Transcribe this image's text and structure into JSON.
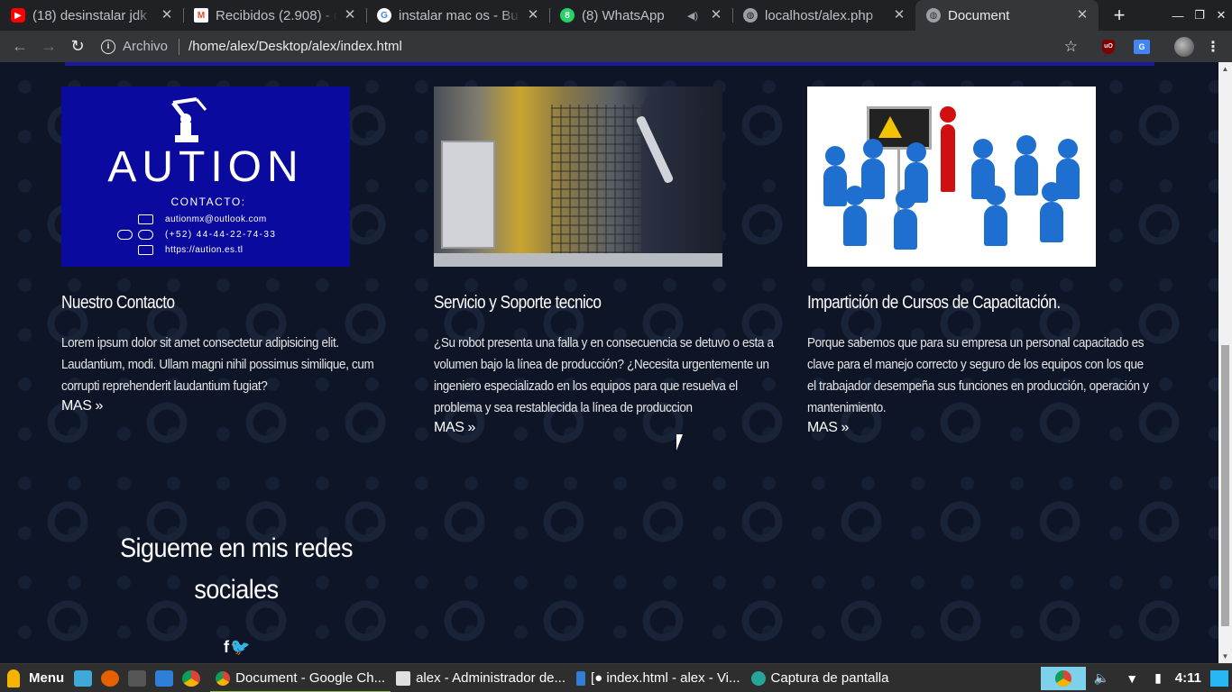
{
  "browser": {
    "tabs": [
      {
        "title": "(18) desinstalar jdk",
        "favicon": "youtube-icon",
        "color": "#ff0000",
        "active": false
      },
      {
        "title": "Recibidos (2.908) - c",
        "favicon": "gmail-icon",
        "color": "#ea4335",
        "active": false
      },
      {
        "title": "instalar mac os - Bu",
        "favicon": "google-icon",
        "color": "#4285f4",
        "active": false
      },
      {
        "title": "(8) WhatsApp",
        "favicon": "whatsapp-icon",
        "color": "#25d366",
        "active": false
      },
      {
        "title": "localhost/alex.php",
        "favicon": "globe-icon",
        "color": "#9aa0a6",
        "active": false
      },
      {
        "title": "Document",
        "favicon": "globe-icon",
        "color": "#9aa0a6",
        "active": true
      }
    ],
    "address": {
      "chip": "Archivo",
      "url": "/home/alex/Desktop/alex/index.html"
    }
  },
  "page": {
    "cards": [
      {
        "title": "Nuestro Contacto",
        "text": "Lorem ipsum dolor sit amet consectetur adipisicing elit. Laudantium, modi. Ullam magni nihil possimus similique, cum corrupti reprehenderit laudantium fugiat?",
        "more": "MAS »"
      },
      {
        "title": "Servicio y Soporte tecnico",
        "text": "¿Su robot presenta una falla y en consecuencia se detuvo o esta a volumen bajo la línea de producción? ¿Necesita urgentemente un ingeniero especializado en los equipos para que resuelva el problema y sea restablecida la línea de produccion",
        "more": "MAS »"
      },
      {
        "title": "Impartición de Cursos de Capacitación.",
        "text": "Porque sabemos que para su empresa un personal capacitado es clave para el manejo correcto y seguro de los equipos con los que el trabajador desempeña sus funciones en producción, operación y mantenimiento.",
        "more": "MAS »"
      }
    ],
    "contact_image": {
      "brand": "AUTION",
      "heading": "CONTACTO:",
      "email": "autionmx@outlook.com",
      "phone": "(+52) 44-44-22-74-33",
      "web": "https://aution.es.tl"
    },
    "social": {
      "title": "Sigueme en mis redes sociales",
      "icons": "f🐦"
    }
  },
  "taskbar": {
    "menu": "Menu",
    "windows": [
      {
        "label": "Document - Google Ch...",
        "icon": "chrome-icon",
        "color": "#4285f4",
        "active": true
      },
      {
        "label": "alex - Administrador de...",
        "icon": "folder-icon",
        "color": "#e0e0e0",
        "active": false
      },
      {
        "label": "[● index.html - alex - Vi...",
        "icon": "vscode-icon",
        "color": "#2f7fd8",
        "active": false
      },
      {
        "label": "Captura de pantalla",
        "icon": "screenshot-icon",
        "color": "#26a69a",
        "active": false
      }
    ],
    "clock": "4:11"
  },
  "colors": {
    "tabbar": "#202124",
    "toolbar": "#35363a",
    "page_bg": "#0d1526",
    "accent_band": "#1a1aa0"
  }
}
